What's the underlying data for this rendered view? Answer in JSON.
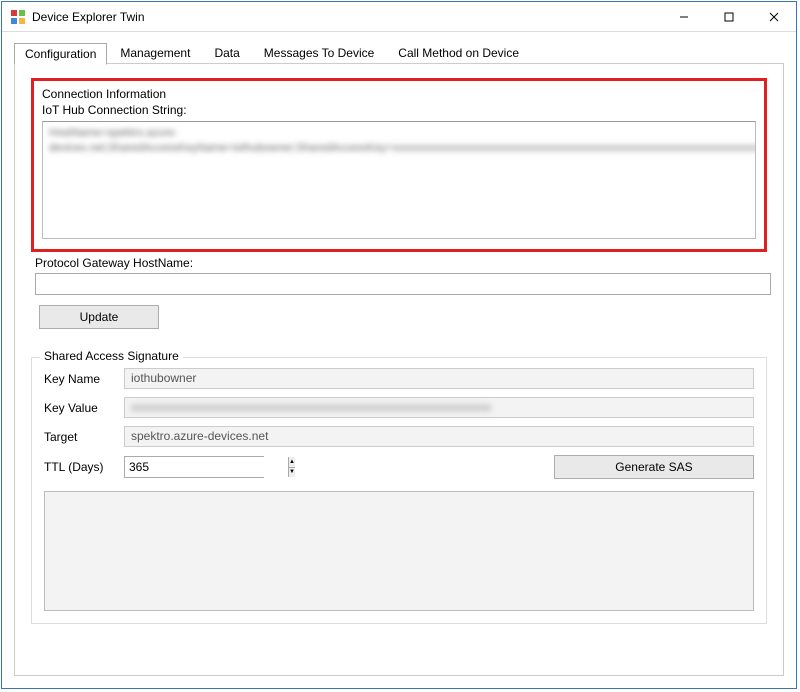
{
  "window": {
    "title": "Device Explorer Twin"
  },
  "tabs": [
    {
      "label": "Configuration",
      "active": true
    },
    {
      "label": "Management",
      "active": false
    },
    {
      "label": "Data",
      "active": false
    },
    {
      "label": "Messages To Device",
      "active": false
    },
    {
      "label": "Call Method on Device",
      "active": false
    }
  ],
  "connection": {
    "group_label": "Connection Information",
    "sub_label": "IoT Hub Connection String:",
    "value_redacted": "HostName=spektro.azure-devices.net;SharedAccessKeyName=iothubowner;SharedAccessKey=xxxxxxxxxxxxxxxxxxxxxxxxxxxxxxxxxxxxxxxxxxxxxxxxxxxxxxxxxxxxxxxxxxxxxxxxxxxxxxxxxxxxxxxxxxxxxxxxxxxxxxxxxxxxxxxxxxxxxxxx"
  },
  "protocol_gateway": {
    "label": "Protocol Gateway HostName:",
    "value": ""
  },
  "buttons": {
    "update": "Update",
    "generate_sas": "Generate SAS"
  },
  "sas": {
    "group_title": "Shared Access Signature",
    "key_name_label": "Key Name",
    "key_name_value": "iothubowner",
    "key_value_label": "Key Value",
    "key_value_redacted": "xxxxxxxxxxxxxxxxxxxxxxxxxxxxxxxxxxxxxxxxxxxxxxxxxxxxxxxxxxxx",
    "target_label": "Target",
    "target_value": "spektro.azure-devices.net",
    "ttl_label": "TTL (Days)",
    "ttl_value": "365"
  }
}
